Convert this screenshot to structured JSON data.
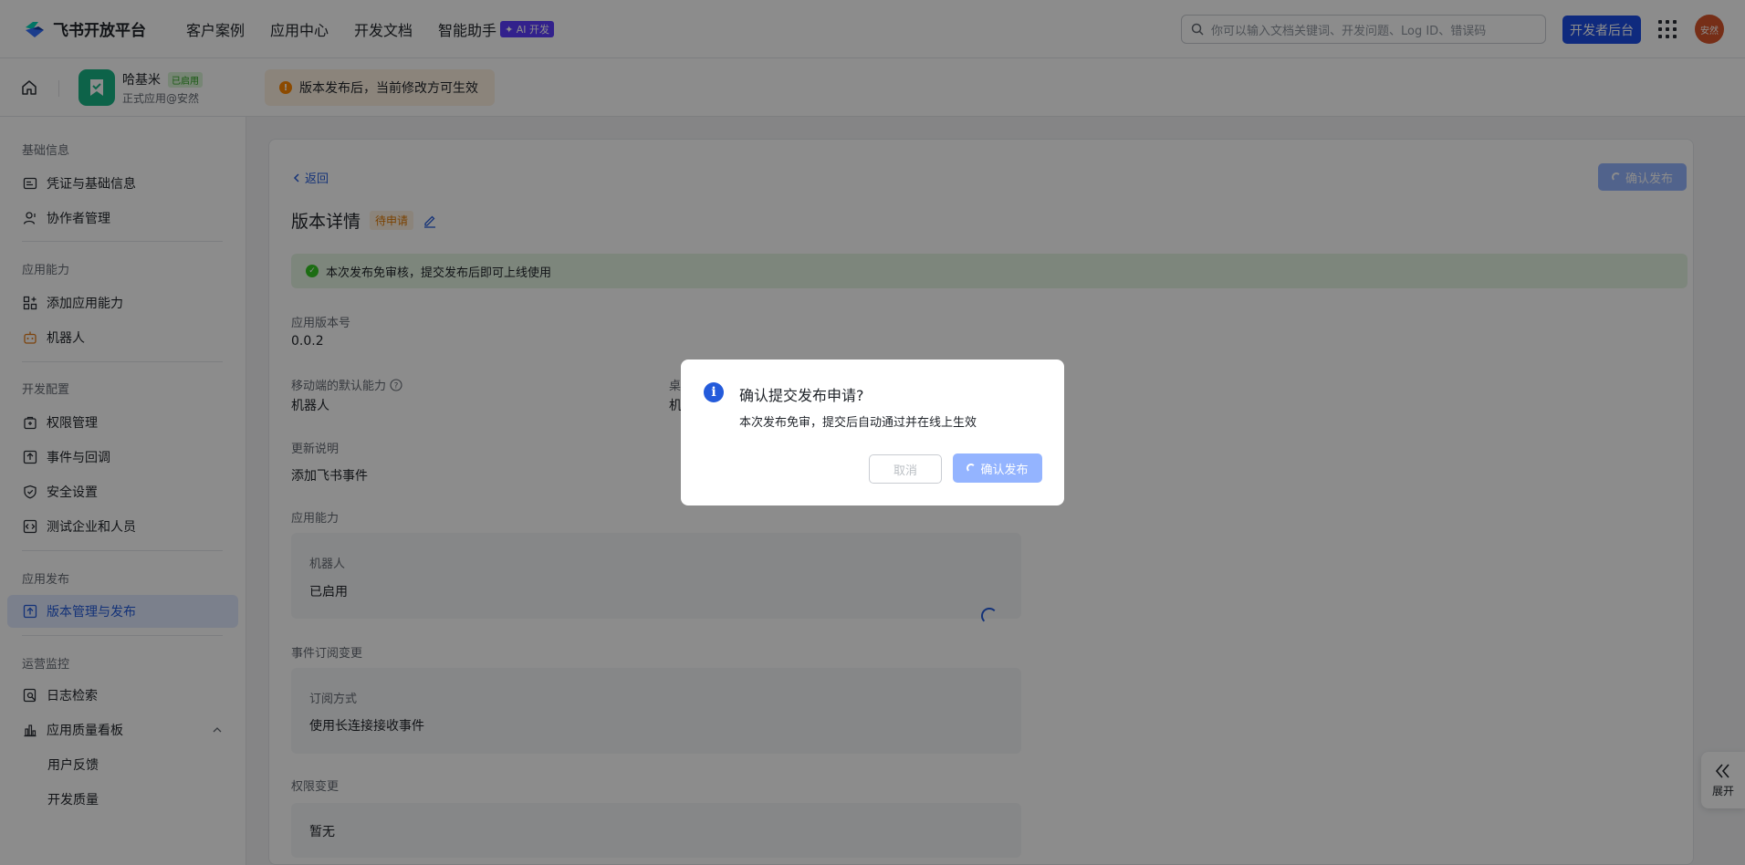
{
  "brand": {
    "name": "飞书开放平台"
  },
  "nav": {
    "links": [
      "客户案例",
      "应用中心",
      "开发文档",
      "智能助手"
    ],
    "ai_badge": "✦ AI 开发",
    "search_placeholder": "你可以输入文档关键词、开发问题、Log ID、错误码",
    "dev_console": "开发者后台",
    "avatar_text": "安然"
  },
  "app": {
    "name": "哈基米",
    "status": "已启用",
    "subtitle": "正式应用@安然",
    "notice": "版本发布后，当前修改方可生效"
  },
  "sidebar": {
    "sections": {
      "basic": "基础信息",
      "capability": "应用能力",
      "devconfig": "开发配置",
      "release": "应用发布",
      "ops": "运营监控"
    },
    "items": {
      "credentials": "凭证与基础信息",
      "collaborators": "协作者管理",
      "add_capability": "添加应用能力",
      "bot": "机器人",
      "permissions": "权限管理",
      "events": "事件与回调",
      "security": "安全设置",
      "test_org": "测试企业和人员",
      "version": "版本管理与发布",
      "logs": "日志检索",
      "quality": "应用质量看板",
      "feedback": "用户反馈",
      "dev_quality": "开发质量"
    }
  },
  "main": {
    "back": "返回",
    "confirm_release": "确认发布",
    "title": "版本详情",
    "status_tag": "待申请",
    "success_msg": "本次发布免审核，提交发布后即可上线使用",
    "version_label": "应用版本号",
    "version_value": "0.0.2",
    "mobile_default_label": "移动端的默认能力",
    "mobile_default_value": "机器人",
    "desktop_default_label": "桌",
    "desktop_default_value": "机",
    "changelog_label": "更新说明",
    "changelog_value": "添加飞书事件",
    "capability_label": "应用能力",
    "capability_box_title": "机器人",
    "capability_box_value": "已启用",
    "event_change_label": "事件订阅变更",
    "event_box_title": "订阅方式",
    "event_box_value": "使用长连接接收事件",
    "perm_change_label": "权限变更",
    "perm_box_value": "暂无",
    "expand": "展开"
  },
  "dialog": {
    "title": "确认提交发布申请?",
    "body": "本次发布免审，提交后自动通过并在线上生效",
    "cancel": "取消",
    "confirm": "确认发布"
  }
}
